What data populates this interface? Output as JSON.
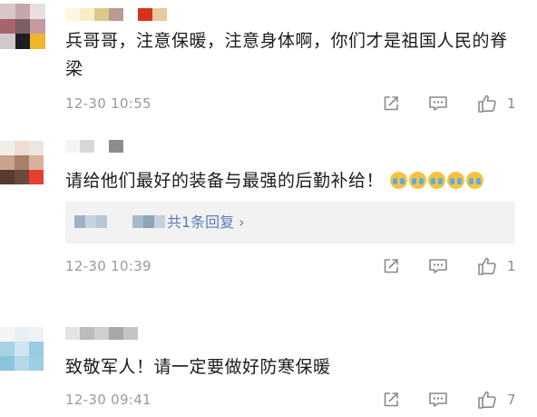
{
  "comments": [
    {
      "text": "兵哥哥，注意保暖，注意身体啊，你们才是祖国人民的脊梁",
      "time": "12-30 10:55",
      "like_count": "1",
      "avatar_colors": [
        "#d9c6c6",
        "#c4a7ab",
        "#e8dede",
        "#a8646b",
        "#7a5f66",
        "#c49aa0",
        "#d0c9cc",
        "#1e1e22",
        "#f0b52a"
      ],
      "name_colors": [
        "#fdf7e0",
        "#f7eec8",
        "#dcc88a",
        "#b89b90",
        "#ffffff",
        "#d6331c",
        "#e8c8a0"
      ]
    },
    {
      "text": "请给他们最好的装备与最强的后勤补给！",
      "emojis": [
        "crying-emoji",
        "crying-emoji",
        "crying-emoji",
        "crying-emoji",
        "crying-emoji"
      ],
      "time": "12-30 10:39",
      "like_count": "1",
      "avatar_colors": [
        "#f1ede8",
        "#f0dcd2",
        "#ece6e2",
        "#c9a38b",
        "#a7806c",
        "#d9b09a",
        "#5a3a2c",
        "#6b4a3b",
        "#e43f2f"
      ],
      "name_colors": [
        "#f5f5f5",
        "#d8d8d8",
        "#ffffff",
        "#8c8c8c"
      ],
      "reply_summary": {
        "text": "共1条回复 ›",
        "blur_colors_a": [
          "#9db4c8",
          "#c4d3de",
          "#b6c7d6"
        ],
        "blur_colors_b": [
          "#a7bacb",
          "#8fa4b8",
          "#c6d2dd"
        ]
      }
    },
    {
      "text": "致敬军人！请一定要做好防寒保暖",
      "time": "12-30 09:41",
      "like_count": "7",
      "avatar_colors": [
        "#f2f4f6",
        "#e9eef2",
        "#eef2f5",
        "#a8d3e6",
        "#cfe6f0",
        "#9acbe2",
        "#8cc3dd",
        "#b4d9ea",
        "#9fcde3"
      ],
      "name_colors": [
        "#e4e4e4",
        "#bcbcbc",
        "#cfcfcf",
        "#a8a8a8",
        "#c4c4c4"
      ]
    }
  ],
  "icons": {
    "share": "share-icon",
    "comment": "comment-icon",
    "like": "thumbs-up-icon"
  }
}
